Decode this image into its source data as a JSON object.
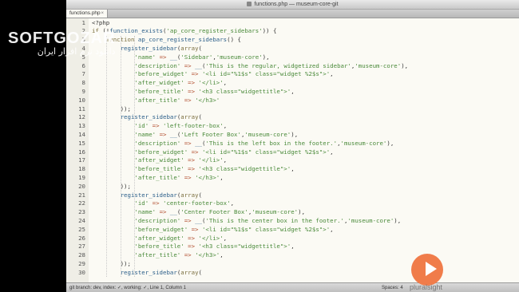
{
  "window": {
    "title": "functions.php — museum-core-git",
    "tab_label": "functions.php",
    "tab_close": "×"
  },
  "editor": {
    "lines": [
      {
        "n": "1",
        "code": "<?php"
      },
      {
        "n": "2",
        "code": "if (!function_exists('ap_core_register_sidebars')) {"
      },
      {
        "n": "3",
        "code": "    function ap_core_register_sidebars() {"
      },
      {
        "n": "4",
        "code": "        register_sidebar(array("
      },
      {
        "n": "5",
        "code": "            'name' => __('Sidebar','museum-core'),"
      },
      {
        "n": "6",
        "code": "            'description' => __('This is the regular, widgetized sidebar','museum-core'),"
      },
      {
        "n": "7",
        "code": "            'before_widget' => '<li id=\"%1$s\" class=\"widget %2$s\">',"
      },
      {
        "n": "8",
        "code": "            'after_widget' => '</li>',"
      },
      {
        "n": "9",
        "code": "            'before_title' => '<h3 class=\"widgettitle\">',"
      },
      {
        "n": "10",
        "code": "            'after_title' => '</h3>'"
      },
      {
        "n": "11",
        "code": "        ));"
      },
      {
        "n": "12",
        "code": "        register_sidebar(array("
      },
      {
        "n": "13",
        "code": "            'id' => 'left-footer-box',"
      },
      {
        "n": "14",
        "code": "            'name' => __('Left Footer Box','museum-core'),"
      },
      {
        "n": "15",
        "code": "            'description' => __('This is the left box in the footer.','museum-core'),"
      },
      {
        "n": "16",
        "code": "            'before_widget' => '<li id=\"%1$s\" class=\"widget %2$s\">',"
      },
      {
        "n": "17",
        "code": "            'after_widget' => '</li>',"
      },
      {
        "n": "18",
        "code": "            'before_title' => '<h3 class=\"widgettitle\">',"
      },
      {
        "n": "19",
        "code": "            'after_title' => '</h3>',"
      },
      {
        "n": "20",
        "code": "        ));"
      },
      {
        "n": "21",
        "code": "        register_sidebar(array("
      },
      {
        "n": "22",
        "code": "            'id' => 'center-footer-box',"
      },
      {
        "n": "23",
        "code": "            'name' => __('Center Footer Box','museum-core'),"
      },
      {
        "n": "24",
        "code": "            'description' => __('This is the center box in the footer.','museum-core'),"
      },
      {
        "n": "25",
        "code": "            'before_widget' => '<li id=\"%1$s\" class=\"widget %2$s\">',"
      },
      {
        "n": "26",
        "code": "            'after_widget' => '</li>',"
      },
      {
        "n": "27",
        "code": "            'before_title' => '<h3 class=\"widgettitle\">',"
      },
      {
        "n": "28",
        "code": "            'after_title' => '</h3>',"
      },
      {
        "n": "29",
        "code": "        ));"
      },
      {
        "n": "30",
        "code": "        register_sidebar(array("
      }
    ]
  },
  "status": {
    "left": "git branch: dev, index: ✓, working: ✓, Line 1, Column 1",
    "right": "Spaces: 4"
  },
  "overlay": {
    "watermark_top": "SOFTGOZAR",
    "watermark_sub": "دانلود نرم افزار ایران",
    "brand": "pluralsight"
  },
  "colors": {
    "keyword": "#7b6f3f",
    "string": "#4a8a3a",
    "function": "#2c5f8a",
    "operator": "#b04a2a",
    "brand": "#f07c4a"
  }
}
